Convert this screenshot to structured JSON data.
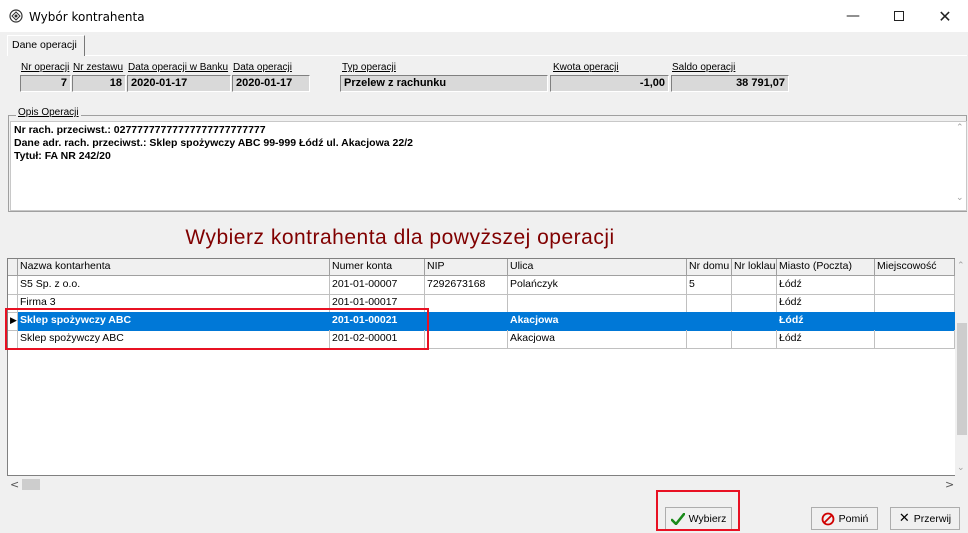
{
  "window": {
    "title": "Wybór kontrahenta"
  },
  "tab": {
    "label": "Dane operacji"
  },
  "operation": {
    "labels": {
      "nr_operacji": "Nr operacji",
      "nr_zestawu": "Nr zestawu",
      "data_bank": "Data operacji w Banku",
      "data_operacji": "Data operacji",
      "typ_operacji": "Typ operacji",
      "kwota_operacji": "Kwota operacji",
      "saldo_operacji": "Saldo operacji"
    },
    "values": {
      "nr_operacji": "7",
      "nr_zestawu": "18",
      "data_bank": "2020-01-17",
      "data_operacji": "2020-01-17",
      "typ_operacji": "Przelew z rachunku",
      "kwota_operacji": "-1,00",
      "saldo_operacji": "38 791,07"
    }
  },
  "opis": {
    "label": "Opis Operacji",
    "lines": [
      "Nr rach. przeciwst.: 02777777777777777777777777",
      "Dane adr. rach. przeciwst.:  Sklep spożywczy ABC 99-999 Łódź ul. Akacjowa 22/2",
      "Tytuł: FA NR 242/20"
    ]
  },
  "heading": "Wybierz kontrahenta dla powyższej operacji",
  "grid": {
    "columns": [
      "Nazwa kontarhenta",
      "Numer konta",
      "NIP",
      "Ulica",
      "Nr domu",
      "Nr loklau",
      "Miasto (Poczta)",
      "Miejscowość"
    ],
    "rows": [
      [
        "S5 Sp. z o.o.",
        "201-01-00007",
        "7292673168",
        "Polańczyk",
        "5",
        "",
        "Łódź",
        ""
      ],
      [
        "Firma 3",
        "201-01-00017",
        "",
        "",
        "",
        "",
        "Łódź",
        ""
      ],
      [
        "Sklep spożywczy ABC",
        "201-01-00021",
        "",
        "Akacjowa",
        "",
        "",
        "Łódź",
        ""
      ],
      [
        "Sklep spożywczy ABC",
        "201-02-00001",
        "",
        "Akacjowa",
        "",
        "",
        "Łódź",
        ""
      ]
    ],
    "selected_row": 2
  },
  "buttons": {
    "wybierz": "Wybierz",
    "pomin": "Pomiń",
    "przerwij": "Przerwij"
  },
  "colors": {
    "selection": "#0078d7",
    "heading": "#800000",
    "highlight_box": "#e81123",
    "check": "#1a8a1a",
    "cancel": "#d00000"
  }
}
